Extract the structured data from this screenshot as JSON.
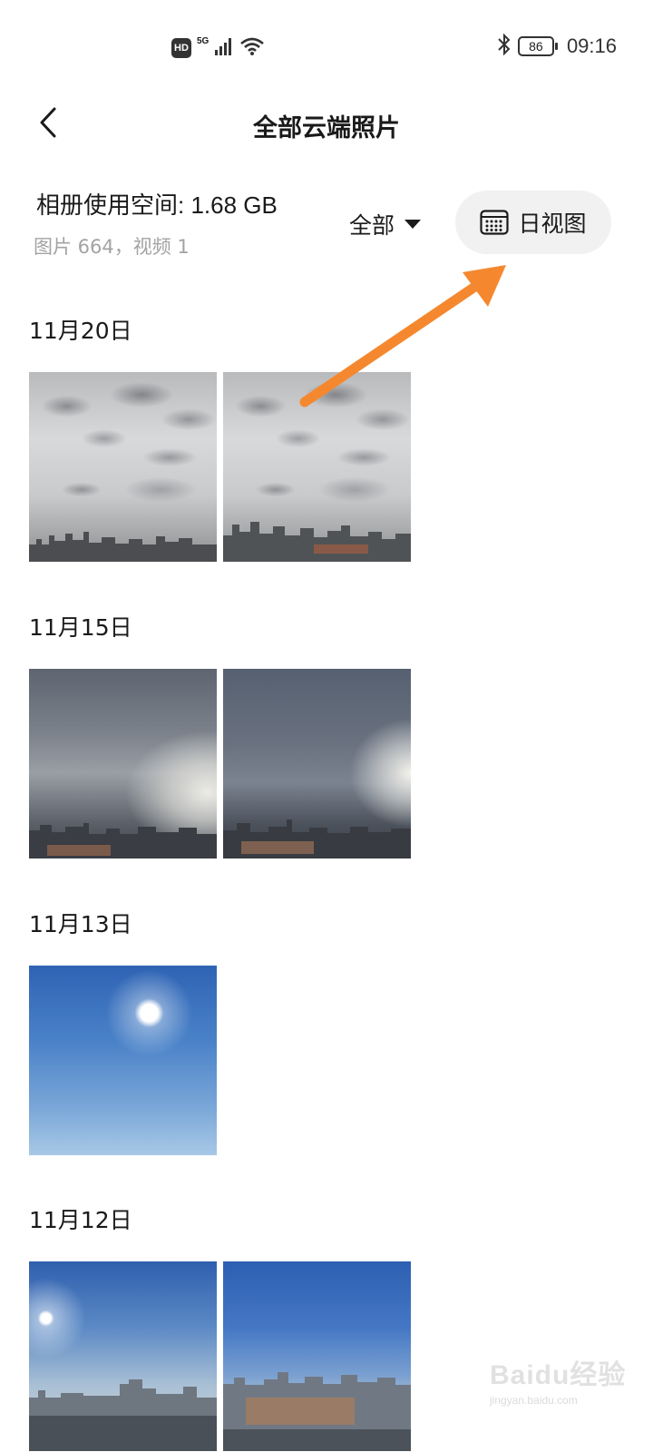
{
  "status_bar": {
    "hd": "HD",
    "network": "5G",
    "battery": "86",
    "time": "09:16",
    "icons": [
      "hd-icon",
      "signal-icon",
      "wifi-icon",
      "bluetooth-icon",
      "battery-icon"
    ]
  },
  "header": {
    "title": "全部云端照片",
    "back_icon": "chevron-left-icon"
  },
  "album_info": {
    "space_used": "相册使用空间: 1.68 GB",
    "counts": "图片 664，视频 1"
  },
  "filter": {
    "label": "全部",
    "icon": "caret-down-icon"
  },
  "day_view": {
    "label": "日视图",
    "icon": "calendar-grid-icon"
  },
  "annotation": {
    "arrow_color": "#f5882e"
  },
  "sections": [
    {
      "date": "11月20日",
      "photos": [
        "cloudy",
        "cloudy"
      ]
    },
    {
      "date": "11月15日",
      "photos": [
        "overcast-a",
        "overcast-b"
      ]
    },
    {
      "date": "11月13日",
      "photos": [
        "sunny"
      ]
    },
    {
      "date": "11月12日",
      "photos": [
        "sunrise",
        "clear-blue"
      ]
    }
  ],
  "watermark": {
    "logo": "Baidu经验",
    "url": "jingyan.baidu.com"
  }
}
